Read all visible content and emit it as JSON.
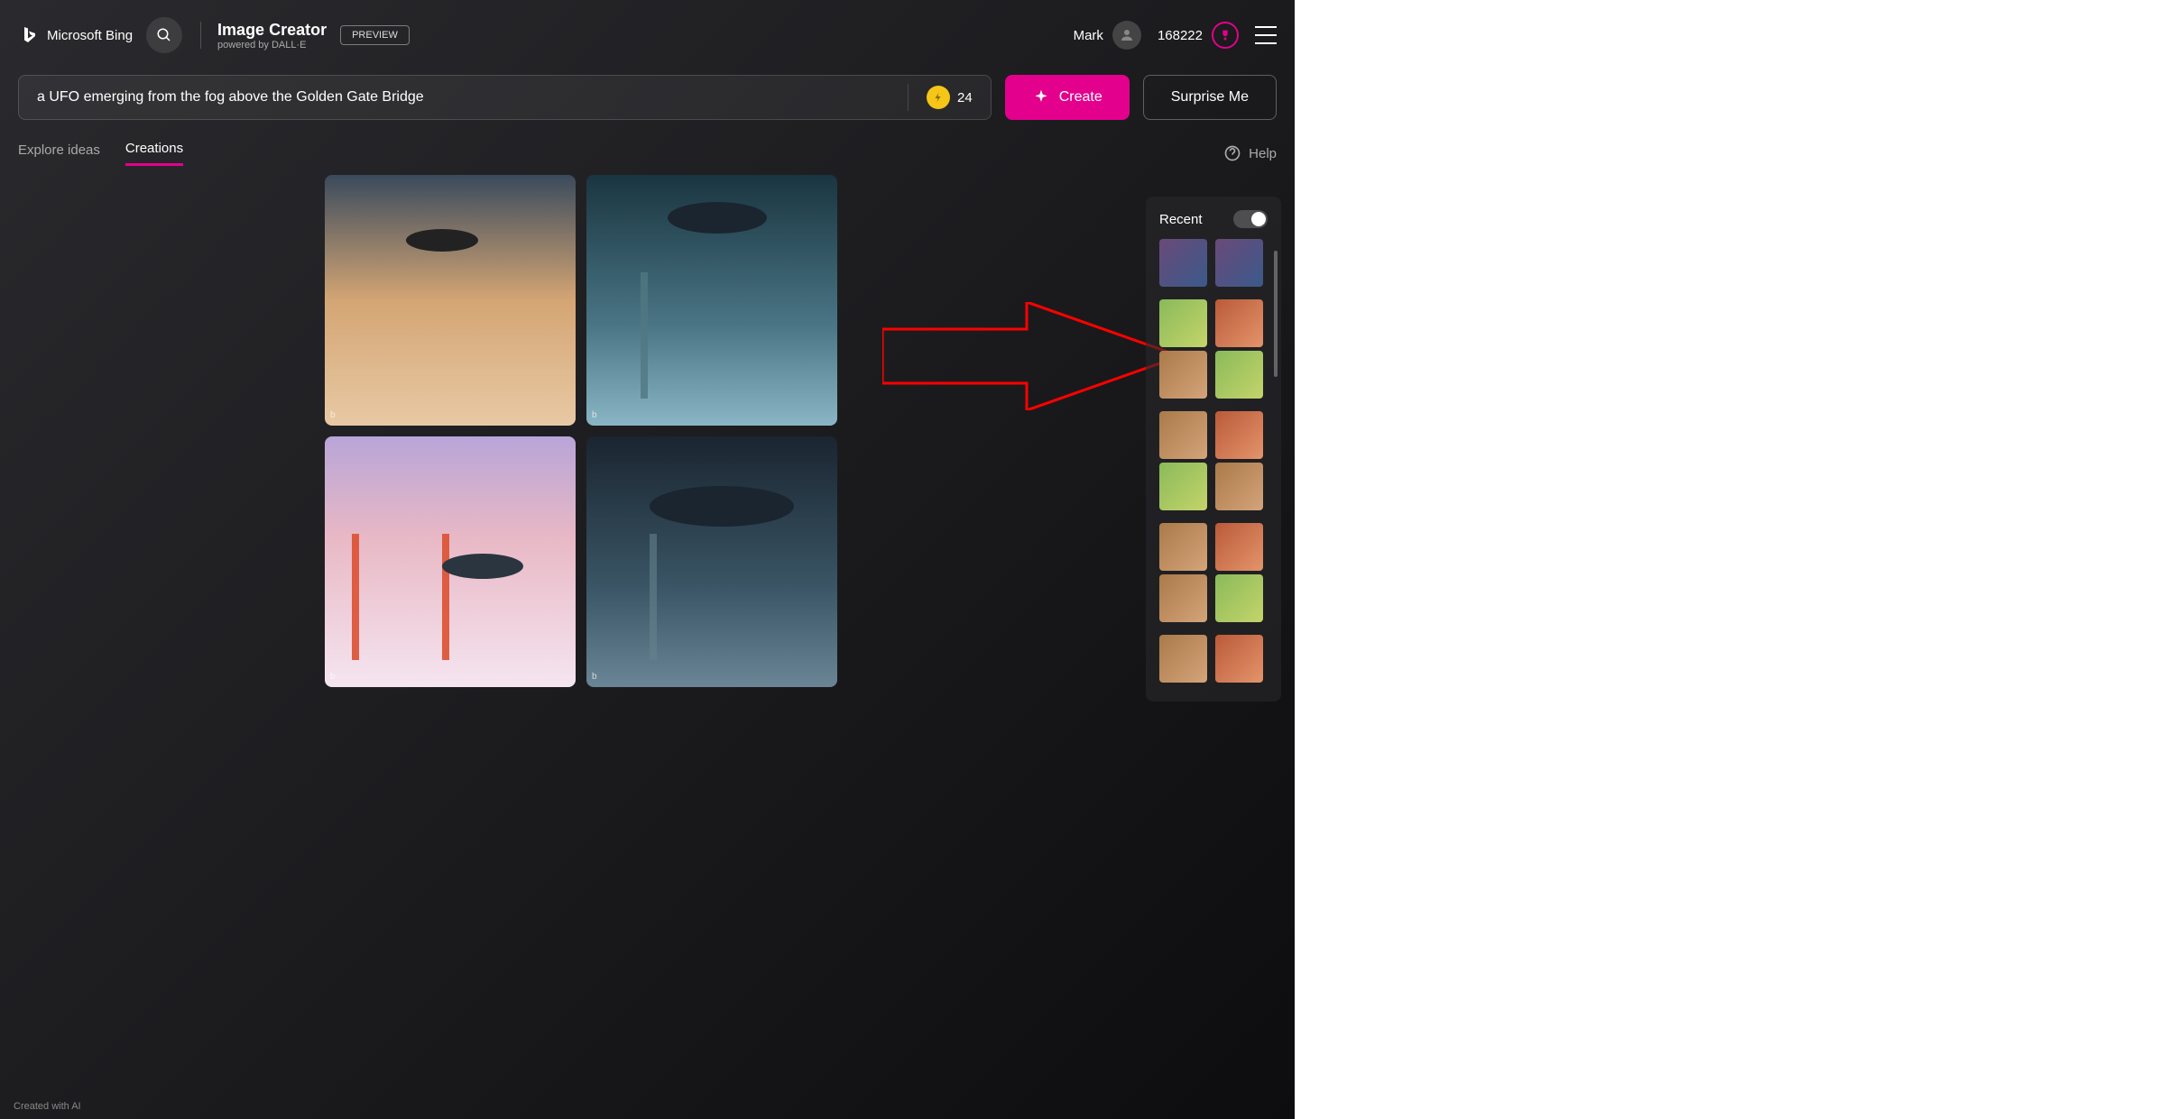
{
  "header": {
    "logo_text": "Microsoft Bing",
    "app_title": "Image Creator",
    "subtitle": "powered by DALL·E",
    "preview_badge": "PREVIEW",
    "username": "Mark",
    "rewards_count": "168222"
  },
  "prompt": {
    "value": "a UFO emerging from the fog above the Golden Gate Bridge",
    "boost_count": "24",
    "create_label": "Create",
    "surprise_label": "Surprise Me"
  },
  "tabs": {
    "explore": "Explore ideas",
    "creations": "Creations",
    "help": "Help"
  },
  "results": {
    "badge": "b"
  },
  "recent": {
    "title": "Recent"
  },
  "footer": {
    "created_with": "Created with AI"
  }
}
